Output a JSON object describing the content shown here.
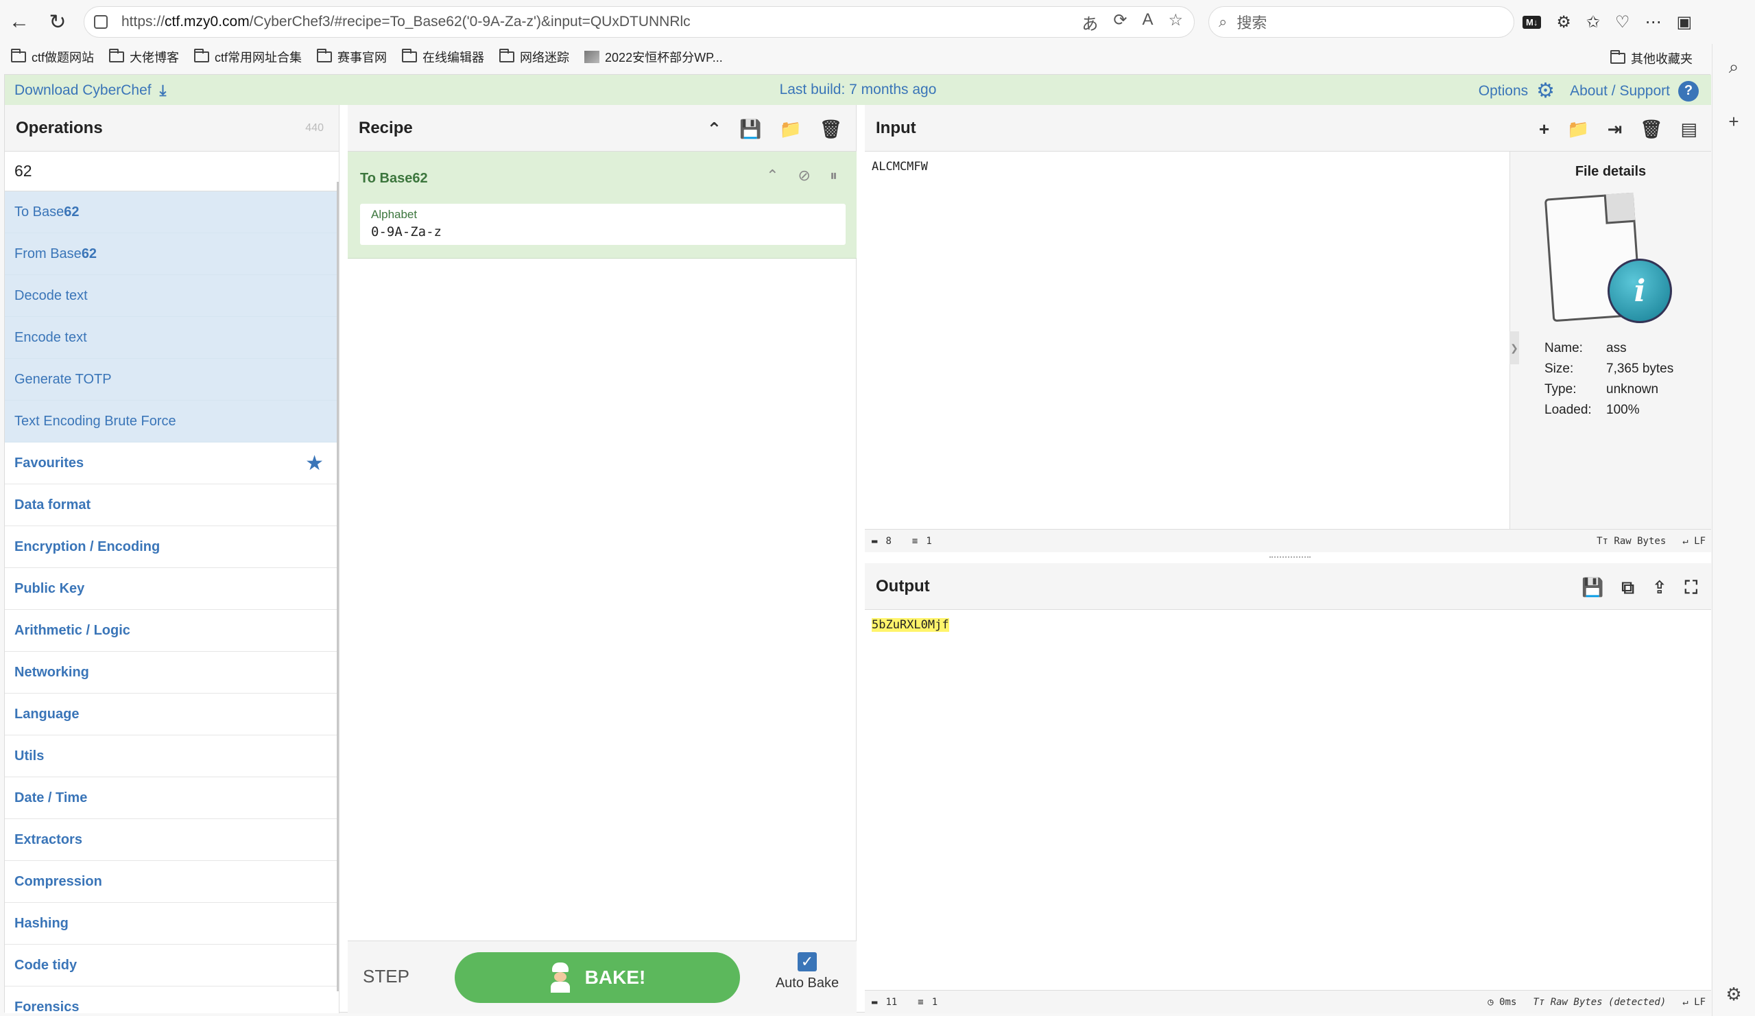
{
  "browser": {
    "url_prefix": "https://",
    "url_host": "ctf.mzy0.com",
    "url_rest": "/CyberChef3/#recipe=To_Base62('0-9A-Za-z')&input=QUxDTUNNRlc",
    "search_placeholder": "搜索",
    "bookmarks": [
      "ctf做题网站",
      "大佬博客",
      "ctf常用网址合集",
      "赛事官网",
      "在线编辑器",
      "网络迷踪",
      "2022安恒杯部分WP..."
    ],
    "other_bookmarks": "其他收藏夹",
    "m_badge": "M↓"
  },
  "banner": {
    "download": "Download CyberChef",
    "last_build": "Last build: 7 months ago",
    "options": "Options",
    "about": "About / Support"
  },
  "operations": {
    "title": "Operations",
    "count": "440",
    "search_value": "62",
    "results": [
      {
        "pre": "To Base",
        "match": "62"
      },
      {
        "pre": "From Base",
        "match": "62"
      },
      {
        "pre": "Decode text",
        "match": ""
      },
      {
        "pre": "Encode text",
        "match": ""
      },
      {
        "pre": "Generate TOTP",
        "match": ""
      },
      {
        "pre": "Text Encoding Brute Force",
        "match": ""
      }
    ],
    "categories": [
      "Favourites",
      "Data format",
      "Encryption / Encoding",
      "Public Key",
      "Arithmetic / Logic",
      "Networking",
      "Language",
      "Utils",
      "Date / Time",
      "Extractors",
      "Compression",
      "Hashing",
      "Code tidy",
      "Forensics"
    ]
  },
  "recipe": {
    "title": "Recipe",
    "op_title": "To Base62",
    "arg_label": "Alphabet",
    "arg_value": "0-9A-Za-z",
    "step": "STEP",
    "bake": "BAKE!",
    "auto_bake": "Auto Bake"
  },
  "input": {
    "title": "Input",
    "value": "ALCMCMFW",
    "chars": "8",
    "lines": "1",
    "encoding": "Raw Bytes",
    "eol": "LF"
  },
  "file_details": {
    "title": "File details",
    "name_k": "Name:",
    "name_v": "ass",
    "size_k": "Size:",
    "size_v": "7,365 bytes",
    "type_k": "Type:",
    "type_v": "unknown",
    "loaded_k": "Loaded:",
    "loaded_v": "100%"
  },
  "output": {
    "title": "Output",
    "value": "5bZuRXL0Mjf",
    "chars": "11",
    "lines": "1",
    "time": "0ms",
    "encoding": "Raw Bytes (detected)",
    "eol": "LF"
  }
}
